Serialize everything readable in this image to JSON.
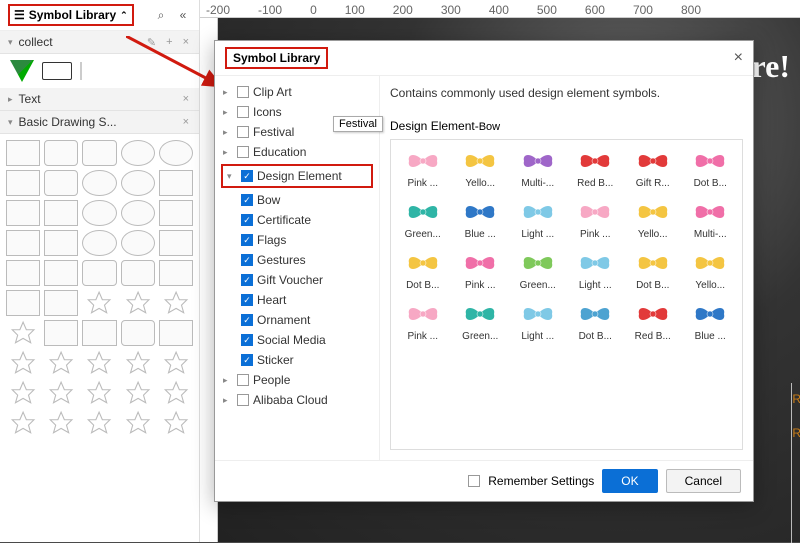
{
  "sidebar": {
    "title": "Symbol Library",
    "sections": [
      {
        "label": "collect"
      },
      {
        "label": "Text"
      },
      {
        "label": "Basic Drawing S..."
      }
    ]
  },
  "ruler_ticks": [
    "-200",
    "-100",
    "0",
    "100",
    "200",
    "300",
    "400",
    "500",
    "600",
    "700",
    "800"
  ],
  "canvas_overlay_text": "ere!",
  "dialog": {
    "title": "Symbol Library",
    "description": "Contains commonly used design element symbols.",
    "tooltip_festival": "Festival",
    "grid_title": "Design Element-",
    "grid_title_sub": "Bow",
    "remember": "Remember Settings",
    "ok": "OK",
    "cancel": "Cancel",
    "tree": [
      {
        "label": "Clip Art",
        "level": 1,
        "checked": false,
        "exp": false
      },
      {
        "label": "Icons",
        "level": 1,
        "checked": false,
        "exp": false
      },
      {
        "label": "Festival",
        "level": 1,
        "checked": false,
        "exp": false
      },
      {
        "label": "Education",
        "level": 1,
        "checked": false,
        "exp": false
      },
      {
        "label": "Design Element",
        "level": 1,
        "checked": true,
        "exp": true,
        "selected": true
      },
      {
        "label": "Bow",
        "level": 2,
        "checked": true
      },
      {
        "label": "Certificate",
        "level": 2,
        "checked": true
      },
      {
        "label": "Flags",
        "level": 2,
        "checked": true
      },
      {
        "label": "Gestures",
        "level": 2,
        "checked": true
      },
      {
        "label": "Gift Voucher",
        "level": 2,
        "checked": true
      },
      {
        "label": "Heart",
        "level": 2,
        "checked": true
      },
      {
        "label": "Ornament",
        "level": 2,
        "checked": true
      },
      {
        "label": "Social Media",
        "level": 2,
        "checked": true
      },
      {
        "label": "Sticker",
        "level": 2,
        "checked": true
      },
      {
        "label": "People",
        "level": 1,
        "checked": false,
        "exp": false
      },
      {
        "label": "Alibaba Cloud",
        "level": 1,
        "checked": false,
        "exp": false
      }
    ],
    "symbols": [
      {
        "label": "Pink ...",
        "color": "#f7a8c4"
      },
      {
        "label": "Yello...",
        "color": "#f4c542"
      },
      {
        "label": "Multi-...",
        "color": "#9f66c9"
      },
      {
        "label": "Red B...",
        "color": "#e23a3a"
      },
      {
        "label": "Gift R...",
        "color": "#e23a3a"
      },
      {
        "label": "Dot B...",
        "color": "#f06fa8"
      },
      {
        "label": "Green...",
        "color": "#2fb5a6"
      },
      {
        "label": "Blue ...",
        "color": "#2f78c7"
      },
      {
        "label": "Light ...",
        "color": "#7fc9e6"
      },
      {
        "label": "Pink ...",
        "color": "#f7a8c4"
      },
      {
        "label": "Yello...",
        "color": "#f4c542"
      },
      {
        "label": "Multi-...",
        "color": "#f06fa8"
      },
      {
        "label": "Dot B...",
        "color": "#f4c542"
      },
      {
        "label": "Pink ...",
        "color": "#f06fa8"
      },
      {
        "label": "Green...",
        "color": "#7fc95b"
      },
      {
        "label": "Light ...",
        "color": "#7fc9e6"
      },
      {
        "label": "Dot B...",
        "color": "#f4c542"
      },
      {
        "label": "Yello...",
        "color": "#f4c542"
      },
      {
        "label": "Pink ...",
        "color": "#f7a8c4"
      },
      {
        "label": "Green...",
        "color": "#2fb5a6"
      },
      {
        "label": "Light ...",
        "color": "#7fc9e6"
      },
      {
        "label": "Dot B...",
        "color": "#4da3d1"
      },
      {
        "label": "Red B...",
        "color": "#e23a3a"
      },
      {
        "label": "Blue ...",
        "color": "#2f78c7"
      }
    ]
  },
  "side_labels": {
    "r1": "R",
    "r2": "R"
  }
}
